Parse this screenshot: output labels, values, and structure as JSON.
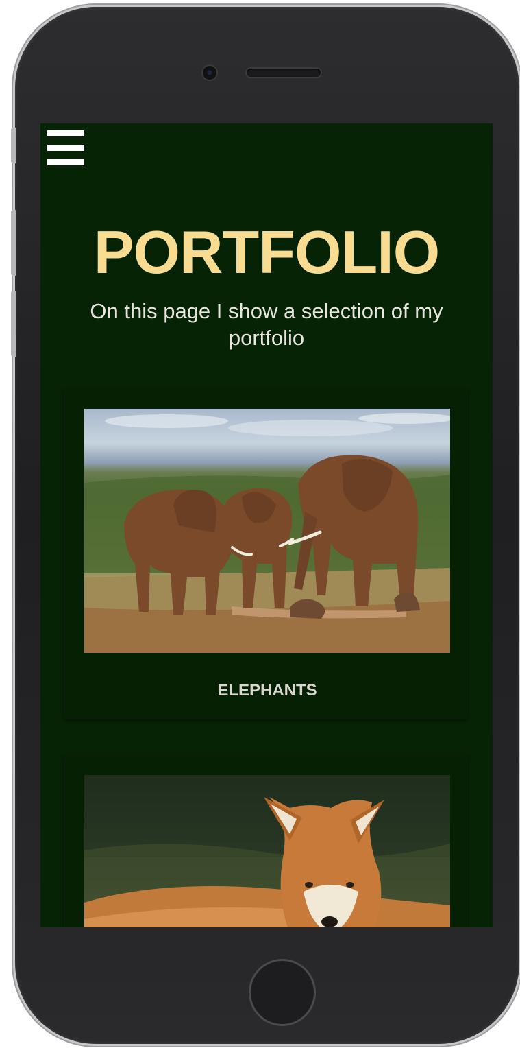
{
  "header": {
    "menu_icon": "hamburger-menu-icon"
  },
  "hero": {
    "title": "PORTFOLIO",
    "subtitle": "On this page I show a selection of my portfolio"
  },
  "portfolio": {
    "items": [
      {
        "caption": "ELEPHANTS",
        "image": "elephants-photo"
      },
      {
        "caption": "",
        "image": "fox-photo"
      }
    ]
  },
  "colors": {
    "page_background": "#062405",
    "card_background": "#052003",
    "title": "#f7dc91",
    "text": "#e9e6df"
  }
}
